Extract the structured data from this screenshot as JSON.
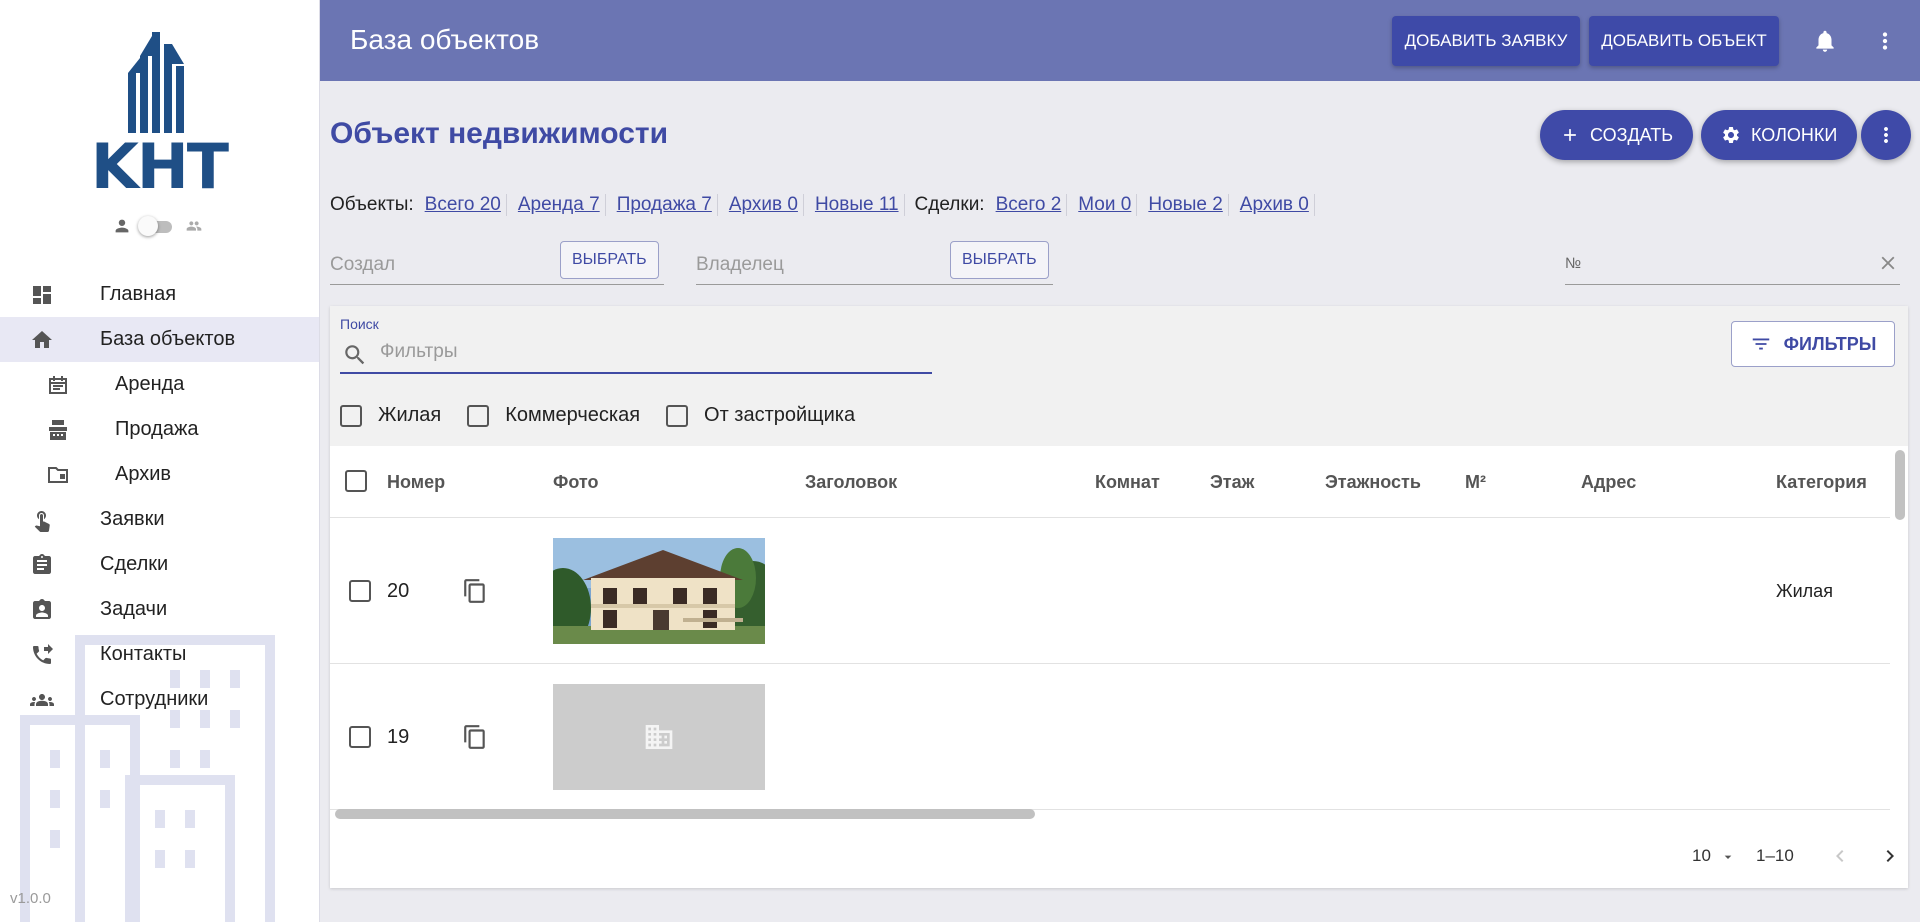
{
  "app": {
    "logo_text": "KHT",
    "version": "v1.0.0"
  },
  "sidebar": {
    "items": [
      {
        "label": "Главная",
        "icon": "dashboard-icon"
      },
      {
        "label": "База объектов",
        "icon": "home-icon",
        "active": true
      },
      {
        "label": "Аренда",
        "icon": "calendar-icon",
        "sub": true
      },
      {
        "label": "Продажа",
        "icon": "cash-register-icon",
        "sub": true
      },
      {
        "label": "Архив",
        "icon": "folder-icon",
        "sub": true
      },
      {
        "label": "Заявки",
        "icon": "tap-icon"
      },
      {
        "label": "Сделки",
        "icon": "clipboard-icon"
      },
      {
        "label": "Задачи",
        "icon": "assignment-ind-icon"
      },
      {
        "label": "Контакты",
        "icon": "phone-forwarded-icon"
      },
      {
        "label": "Сотрудники",
        "icon": "people-icon"
      }
    ]
  },
  "topbar": {
    "title": "База объектов",
    "add_request": "ДОБАВИТЬ ЗАЯВКУ",
    "add_object": "ДОБАВИТЬ ОБЪЕКТ"
  },
  "main": {
    "title": "Объект недвижимости",
    "create": "СОЗДАТЬ",
    "columns": "КОЛОНКИ",
    "objects_label": "Объекты:",
    "object_links": [
      "Всего 20",
      "Аренда 7",
      "Продажа 7",
      "Архив 0",
      "Новые 11"
    ],
    "deals_label": "Сделки:",
    "deal_links": [
      "Всего 2",
      "Мои 0",
      "Новые 2",
      "Архив 0"
    ],
    "created_by_placeholder": "Создал",
    "owner_placeholder": "Владелец",
    "select_btn": "ВЫБРАТЬ",
    "number_placeholder": "№"
  },
  "search": {
    "label": "Поиск",
    "placeholder": "Фильтры",
    "filters_btn": "ФИЛЬТРЫ",
    "checks": [
      "Жилая",
      "Коммерческая",
      "От застройщика"
    ]
  },
  "table": {
    "columns": [
      "Номер",
      "Фото",
      "Заголовок",
      "Комнат",
      "Этаж",
      "Этажность",
      "М²",
      "Адрес",
      "Категория"
    ],
    "rows": [
      {
        "number": "20",
        "category": "Жилая",
        "photo": "house-photo"
      },
      {
        "number": "19",
        "category": "",
        "photo": "placeholder-building-icon"
      }
    ]
  },
  "pager": {
    "rows_per_page": "10",
    "range": "1–10"
  },
  "colors": {
    "primary": "#3f4aa8",
    "topbar": "#6b75b3",
    "logo": "#1f4f86"
  }
}
